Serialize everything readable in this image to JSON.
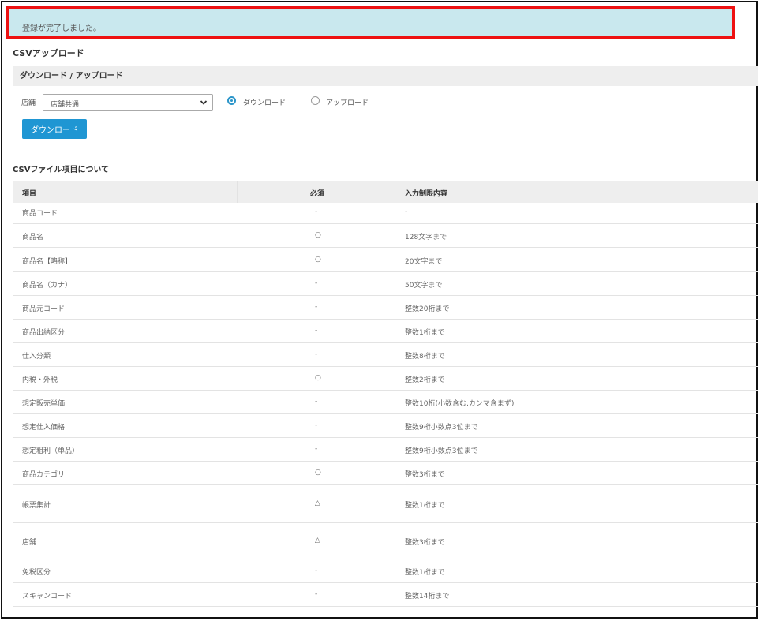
{
  "notice": {
    "message": "登録が完了しました。"
  },
  "page": {
    "title": "CSVアップロード"
  },
  "panel": {
    "header": "ダウンロード / アップロード"
  },
  "store_select": {
    "label": "店舗",
    "value": "店舗共通"
  },
  "mode": {
    "options": [
      {
        "label": "ダウンロード",
        "selected": true
      },
      {
        "label": "アップロード",
        "selected": false
      }
    ]
  },
  "download_button": {
    "label": "ダウンロード"
  },
  "fields_table": {
    "title": "CSVファイル項目について",
    "headers": {
      "item": "項目",
      "required": "必須",
      "limits": "入力制限内容"
    },
    "rows": [
      {
        "item": "商品コード",
        "required": "-",
        "limit": "-"
      },
      {
        "item": "商品名",
        "required": "○",
        "limit": "128文字まで"
      },
      {
        "item": "商品名【略称】",
        "required": "○",
        "limit": "20文字まで"
      },
      {
        "item": "商品名（カナ）",
        "required": "-",
        "limit": "50文字まで"
      },
      {
        "item": "商品元コード",
        "required": "-",
        "limit": "整数20桁まで"
      },
      {
        "item": "商品出納区分",
        "required": "-",
        "limit": "整数1桁まで"
      },
      {
        "item": "仕入分類",
        "required": "-",
        "limit": "整数8桁まで"
      },
      {
        "item": "内税・外税",
        "required": "○",
        "limit": "整数2桁まで"
      },
      {
        "item": "想定販売単価",
        "required": "-",
        "limit": "整数10桁(小数含む,カンマ含まず)"
      },
      {
        "item": "想定仕入価格",
        "required": "-",
        "limit": "整数9桁小数点3位まで"
      },
      {
        "item": "想定粗利（単品）",
        "required": "-",
        "limit": "整数9桁小数点3位まで"
      },
      {
        "item": "商品カテゴリ",
        "required": "○",
        "limit": "整数3桁まで"
      },
      {
        "item": "帳票集計",
        "required": "△",
        "limit": "整数1桁まで"
      },
      {
        "item": "店舗",
        "required": "△",
        "limit": "整数3桁まで"
      },
      {
        "item": "免税区分",
        "required": "-",
        "limit": "整数1桁まで"
      },
      {
        "item": "スキャンコード",
        "required": "-",
        "limit": "整数14桁まで"
      }
    ]
  }
}
